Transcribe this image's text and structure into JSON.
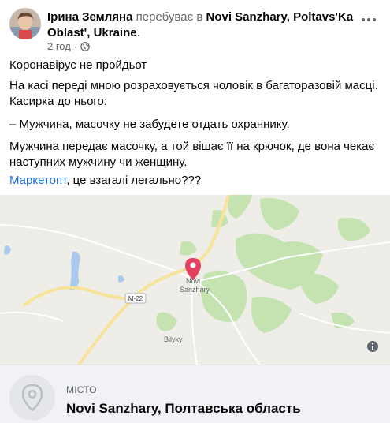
{
  "post": {
    "author": "Ірина Землянa",
    "verb": "перебуває в",
    "place_line1": "Novi Sanzhary, Poltavs'Ka",
    "place_line2": "Oblast', Ukraine",
    "period": ".",
    "time": "2 год",
    "meta_separator": "·",
    "privacy_icon": "globe-icon",
    "more_icon": "more-options-icon"
  },
  "content": {
    "p0": "Коронавірус не пройдьот",
    "p1_line1": "На касі переді мною розраховується чоловік в багаторазовій масці.",
    "p1_line2": "Касирка до нього:",
    "p2": "– Мужчина, масочку не забудете отдать охраннику.",
    "p3_line1": "Мужчина передає масочку, а той вішає її на крючок, де вона чекає",
    "p3_line2": "наступних мужчину чи женщину.",
    "p4_link": "Маркетопт",
    "p4_rest": ", це взагалі легально???"
  },
  "map": {
    "road_label": "M-22",
    "town_label_1": "Novi",
    "town_label_2": "Sanzhary",
    "village_label": "Bilyky",
    "pin_color": "#e4405f",
    "info_icon": "info-icon"
  },
  "place_card": {
    "kind": "МІСТО",
    "name": "Novi Sanzhary, Полтавська область",
    "icon": "location-pin-icon"
  }
}
